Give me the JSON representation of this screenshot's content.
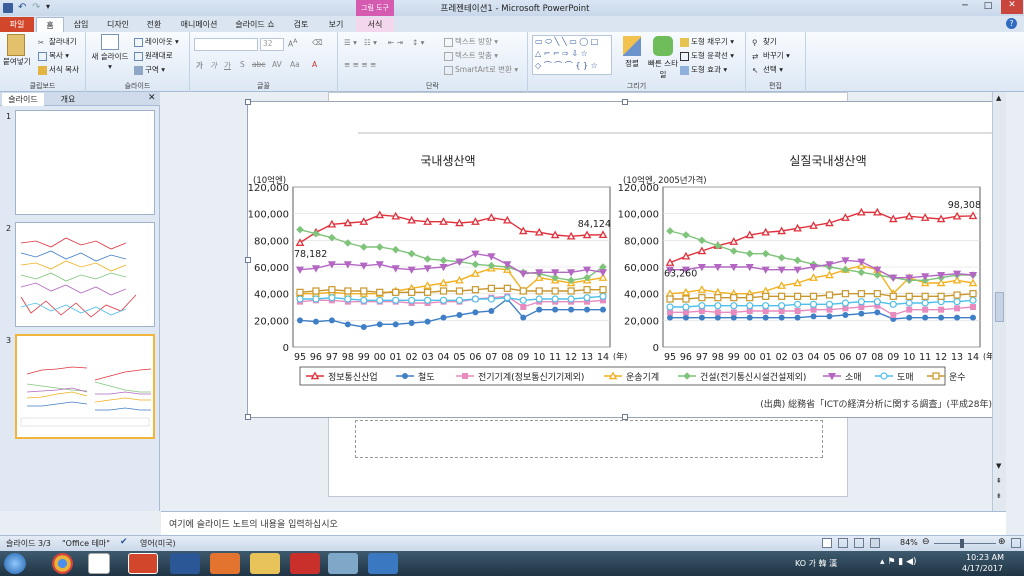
{
  "window": {
    "title": "프레젠테이션1 - Microsoft PowerPoint",
    "contextual_group": "그림 도구"
  },
  "tabs": [
    "파일",
    "홈",
    "삽입",
    "디자인",
    "전환",
    "애니메이션",
    "슬라이드 쇼",
    "검토",
    "보기",
    "서식"
  ],
  "ribbon": {
    "clipboard": {
      "paste": "붙여넣기",
      "cut": "잘라내기",
      "copy": "복사",
      "format_painter": "서식 복사",
      "label": "클립보드"
    },
    "slides": {
      "new_slide": "새 슬라이드",
      "layout": "레이아웃",
      "reset": "원래대로",
      "section": "구역",
      "label": "슬라이드"
    },
    "font": {
      "size": "32",
      "label": "글꼴"
    },
    "paragraph": {
      "text_direction": "텍스트 방향",
      "align_text": "텍스트 맞춤",
      "smartart": "SmartArt로 변환",
      "label": "단락"
    },
    "drawing": {
      "arrange": "정렬",
      "quick_styles": "빠른 스타일",
      "fill": "도형 채우기",
      "outline": "도형 윤곽선",
      "effects": "도형 효과",
      "label": "그리기"
    },
    "editing": {
      "find": "찾기",
      "replace": "바꾸기",
      "select": "선택",
      "label": "편집"
    }
  },
  "pane": {
    "tab_slides": "슬라이드",
    "tab_outline": "개요",
    "slide_numbers": [
      "1",
      "2",
      "3"
    ]
  },
  "slide": {
    "source": "(出典) 総務省「ICTの経済分析に関する調査」(平成28年)",
    "legend": [
      "정보통신산업",
      "철도",
      "전기기계(정보통신기기제외)",
      "운송기계",
      "건설(전기통신시설건설제외)",
      "소매",
      "도매",
      "운수"
    ],
    "year_unit": "(年)"
  },
  "chart_data": [
    {
      "type": "line",
      "title": "국내생산액",
      "ylabel": "(10억엔)",
      "ylim": [
        0,
        120000
      ],
      "yticks": [
        "0",
        "20,000",
        "40,000",
        "60,000",
        "80,000",
        "100,000",
        "120,000"
      ],
      "x": [
        "95",
        "96",
        "97",
        "98",
        "99",
        "00",
        "01",
        "02",
        "03",
        "04",
        "05",
        "06",
        "07",
        "08",
        "09",
        "10",
        "11",
        "12",
        "13",
        "14"
      ],
      "annotations": [
        "78,182",
        "84,124"
      ],
      "series": [
        {
          "name": "정보통신산업",
          "color": "#e0313c",
          "marker": "triangle",
          "values": [
            78182,
            86000,
            92000,
            93000,
            94000,
            99000,
            98000,
            95000,
            94000,
            94000,
            93000,
            94000,
            97000,
            95000,
            87000,
            86000,
            84000,
            83000,
            84000,
            84124
          ]
        },
        {
          "name": "철도",
          "color": "#3f7fc6",
          "marker": "circle",
          "values": [
            20000,
            19000,
            20000,
            17000,
            15000,
            17000,
            17000,
            18000,
            19000,
            22000,
            24000,
            26000,
            27000,
            36000,
            22000,
            28000,
            28000,
            28000,
            28000,
            28000
          ]
        },
        {
          "name": "전기기계(정보통신기기제외)",
          "color": "#e88cc0",
          "marker": "square",
          "values": [
            34000,
            35000,
            35000,
            34000,
            34000,
            34000,
            34000,
            33000,
            33000,
            34000,
            34000,
            36000,
            37000,
            38000,
            30000,
            34000,
            34000,
            34000,
            34000,
            35000
          ]
        },
        {
          "name": "운송기계",
          "color": "#f2b01e",
          "marker": "triangle",
          "values": [
            40000,
            40000,
            41000,
            40000,
            40000,
            40000,
            42000,
            44000,
            46000,
            48000,
            50000,
            55000,
            59000,
            58000,
            42000,
            52000,
            50000,
            48000,
            50000,
            52000
          ]
        },
        {
          "name": "건설(전기통신시설건설제외)",
          "color": "#7fc47a",
          "marker": "diamond",
          "values": [
            88000,
            85000,
            82000,
            78000,
            75000,
            75000,
            73000,
            70000,
            66000,
            65000,
            64000,
            62000,
            61000,
            60000,
            56000,
            55000,
            52000,
            50000,
            52000,
            60000
          ]
        },
        {
          "name": "소매",
          "color": "#b467c2",
          "marker": "triangle-down",
          "values": [
            58000,
            59000,
            62000,
            62000,
            61000,
            62000,
            59000,
            58000,
            59000,
            60000,
            64000,
            70000,
            68000,
            62000,
            55000,
            56000,
            56000,
            56000,
            58000,
            56000
          ]
        },
        {
          "name": "도매",
          "color": "#4dbfe8",
          "marker": "circle-open",
          "values": [
            36000,
            36000,
            37000,
            36000,
            35000,
            35000,
            35000,
            35000,
            35000,
            35000,
            35000,
            36000,
            36000,
            37000,
            35000,
            36000,
            36000,
            36000,
            37000,
            38000
          ]
        },
        {
          "name": "운수",
          "color": "#c9962b",
          "marker": "square-open",
          "values": [
            41000,
            42000,
            43000,
            42000,
            42000,
            41000,
            41000,
            41000,
            41000,
            42000,
            42000,
            43000,
            44000,
            44000,
            42000,
            42000,
            42000,
            42000,
            43000,
            43000
          ]
        }
      ]
    },
    {
      "type": "line",
      "title": "실질국내생산액",
      "ylabel": "(10억엔, 2005년가격)",
      "ylim": [
        0,
        120000
      ],
      "yticks": [
        "0",
        "20,000",
        "40,000",
        "60,000",
        "80,000",
        "100,000",
        "120,000"
      ],
      "x": [
        "95",
        "96",
        "97",
        "98",
        "99",
        "00",
        "01",
        "02",
        "03",
        "04",
        "05",
        "06",
        "07",
        "08",
        "09",
        "10",
        "11",
        "12",
        "13",
        "14"
      ],
      "annotations": [
        "63,260",
        "98,308"
      ],
      "series": [
        {
          "name": "정보통신산업",
          "color": "#e0313c",
          "marker": "triangle",
          "values": [
            63260,
            68000,
            72000,
            76000,
            79000,
            84000,
            86000,
            87000,
            89000,
            91000,
            93000,
            97000,
            101000,
            101000,
            96000,
            98000,
            97000,
            96000,
            98000,
            98308
          ]
        },
        {
          "name": "철도",
          "color": "#3f7fc6",
          "marker": "circle",
          "values": [
            22000,
            22000,
            22000,
            22000,
            22000,
            22000,
            22000,
            22000,
            22000,
            23000,
            23000,
            24000,
            25000,
            26000,
            21000,
            22000,
            22000,
            22000,
            22000,
            22000
          ]
        },
        {
          "name": "전기기계(정보통신기기제외)",
          "color": "#e88cc0",
          "marker": "square",
          "values": [
            26000,
            26000,
            27000,
            26000,
            26000,
            27000,
            27000,
            27000,
            27000,
            28000,
            28000,
            29000,
            30000,
            31000,
            24000,
            28000,
            28000,
            28000,
            29000,
            30000
          ]
        },
        {
          "name": "운송기계",
          "color": "#f2b01e",
          "marker": "triangle",
          "values": [
            40000,
            41000,
            43000,
            41000,
            40000,
            40000,
            42000,
            46000,
            48000,
            52000,
            54000,
            58000,
            61000,
            58000,
            40000,
            52000,
            48000,
            48000,
            50000,
            48000
          ]
        },
        {
          "name": "건설(전기통신시설건설제외)",
          "color": "#7fc47a",
          "marker": "diamond",
          "values": [
            87000,
            84000,
            80000,
            76000,
            72000,
            70000,
            70000,
            67000,
            65000,
            62000,
            60000,
            58000,
            56000,
            54000,
            52000,
            50000,
            50000,
            52000,
            54000,
            54000
          ]
        },
        {
          "name": "소매",
          "color": "#b467c2",
          "marker": "triangle-down",
          "values": [
            58000,
            58000,
            60000,
            60000,
            60000,
            60000,
            58000,
            58000,
            58000,
            60000,
            62000,
            65000,
            64000,
            58000,
            52000,
            52000,
            53000,
            54000,
            55000,
            54000
          ]
        },
        {
          "name": "도매",
          "color": "#4dbfe8",
          "marker": "circle-open",
          "values": [
            30000,
            30000,
            31000,
            31000,
            31000,
            31000,
            31000,
            31000,
            32000,
            32000,
            32000,
            33000,
            34000,
            34000,
            32000,
            33000,
            33000,
            34000,
            34000,
            35000
          ]
        },
        {
          "name": "운수",
          "color": "#c9962b",
          "marker": "square-open",
          "values": [
            36000,
            36000,
            37000,
            37000,
            37000,
            37000,
            38000,
            38000,
            38000,
            38000,
            39000,
            40000,
            40000,
            40000,
            38000,
            38000,
            38000,
            38000,
            39000,
            40000
          ]
        }
      ]
    }
  ],
  "notes": {
    "placeholder": "여기에 슬라이드 노트의 내용을 입력하십시오"
  },
  "status": {
    "slide": "슬라이드 3/3",
    "theme": "\"Office 테마\"",
    "language": "영어(미국)",
    "zoom": "84%"
  },
  "taskbar": {
    "ime": "KO 가 韓 漢",
    "time": "10:23 AM",
    "date": "4/17/2017"
  }
}
